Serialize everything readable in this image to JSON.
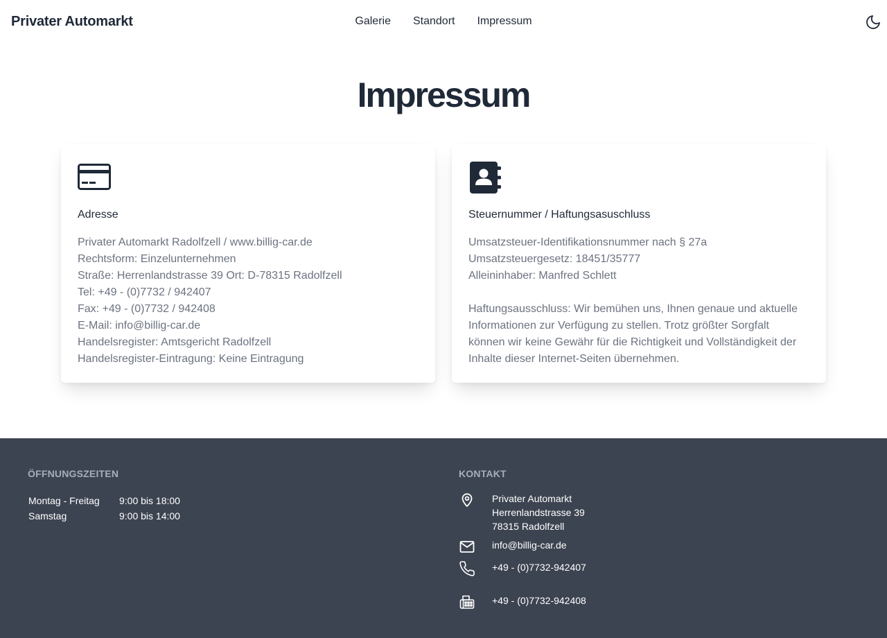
{
  "header": {
    "brand": "Privater Automarkt",
    "nav": [
      {
        "label": "Galerie"
      },
      {
        "label": "Standort"
      },
      {
        "label": "Impressum"
      }
    ],
    "theme_toggle_icon": "moon-icon"
  },
  "page": {
    "title": "Impressum"
  },
  "cards": {
    "address": {
      "icon": "credit-card-icon",
      "heading": "Adresse",
      "lines": [
        "Privater Automarkt Radolfzell / www.billig-car.de",
        "Rechtsform: Einzelunternehmen",
        "Straße: Herrenlandstrasse 39 Ort: D-78315 Radolfzell",
        "Tel: +49 - (0)7732 / 942407",
        "Fax: +49 - (0)7732 / 942408",
        "E-Mail: info@billig-car.de",
        "Handelsregister: Amtsgericht Radolfzell",
        "Handelsregister-Eintragung: Keine Eintragung"
      ]
    },
    "tax": {
      "icon": "address-book-icon",
      "heading": "Steuernummer / Haftungsasuschluss",
      "lines": [
        "Umsatzsteuer-Identifikationsnummer nach § 27a",
        "Umsatzsteuergesetz: 18451/35777",
        "Alleininhaber: Manfred Schlett"
      ],
      "disclaimer_lines": [
        "Haftungsausschluss: Wir bemühen uns, Ihnen genaue und aktuelle",
        "Informationen zur Verfügung zu stellen. Trotz größter Sorgfalt",
        "können wir keine Gewähr für die Richtigkeit und Vollständigkeit der",
        "Inhalte dieser Internet-Seiten übernehmen."
      ]
    }
  },
  "footer": {
    "hours": {
      "title": "Öffnungszeiten",
      "rows": [
        {
          "day": "Montag - Freitag",
          "time": "9:00 bis 18:00"
        },
        {
          "day": "Samstag",
          "time": "9:00 bis 14:00"
        }
      ]
    },
    "contact": {
      "title": "Kontakt",
      "address_lines": [
        "Privater Automarkt",
        "Herrenlandstrasse 39",
        "78315 Radolfzell"
      ],
      "email": "info@billig-car.de",
      "phone": "+49 - (0)7732-942407",
      "fax": "+49 - (0)7732-942408"
    }
  },
  "colors": {
    "text": "#1f2937",
    "muted": "#6b7280",
    "footer_bg": "#3d4451",
    "footer_title": "#a6adbb"
  }
}
